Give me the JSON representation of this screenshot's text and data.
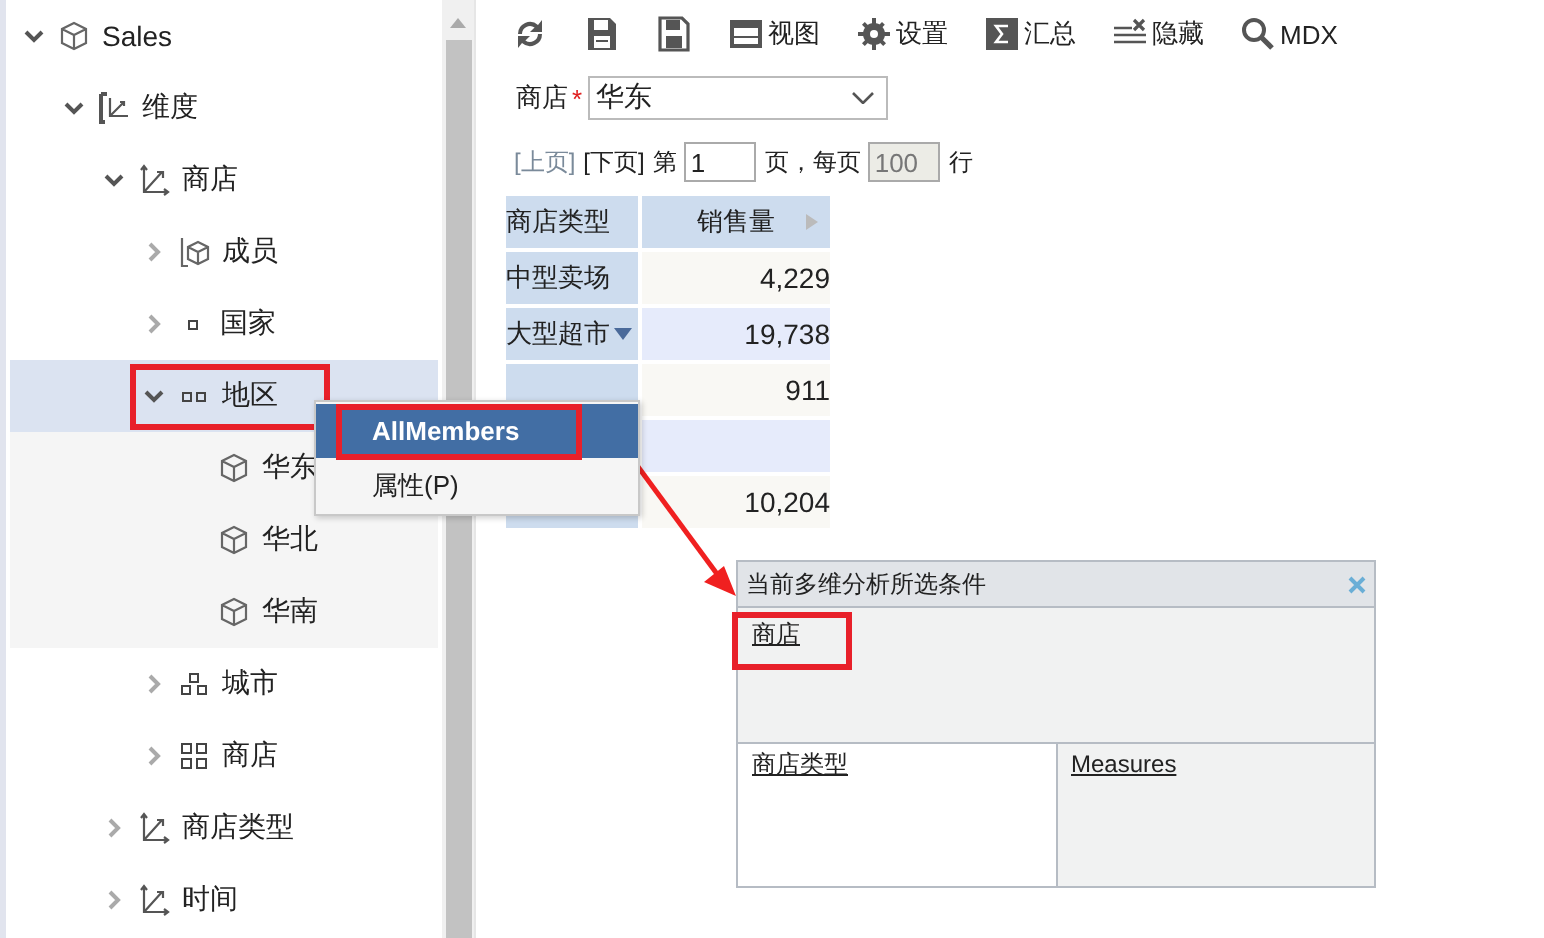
{
  "tree": [
    {
      "label": "Sales",
      "kind": "cube",
      "expanded": true,
      "selected": false,
      "highlighted": false,
      "children": [
        {
          "label": "维度",
          "kind": "dimensions",
          "expanded": true,
          "selected": false,
          "highlighted": false,
          "children": [
            {
              "label": "商店",
              "kind": "hierarchy",
              "expanded": true,
              "selected": false,
              "highlighted": false,
              "children": [
                {
                  "label": "成员",
                  "kind": "members",
                  "expanded": false,
                  "selected": false,
                  "highlighted": false
                },
                {
                  "label": "国家",
                  "kind": "dot",
                  "expanded": false,
                  "selected": false,
                  "highlighted": false
                },
                {
                  "label": "地区",
                  "kind": "pair",
                  "expanded": true,
                  "selected": true,
                  "highlighted": true,
                  "children": [
                    {
                      "label": "华东",
                      "kind": "cube",
                      "selected": false,
                      "highlighted": false
                    },
                    {
                      "label": "华北",
                      "kind": "cube",
                      "selected": false,
                      "highlighted": false
                    },
                    {
                      "label": "华南",
                      "kind": "cube",
                      "selected": false,
                      "highlighted": false
                    }
                  ]
                },
                {
                  "label": "城市",
                  "kind": "triple",
                  "expanded": false,
                  "selected": false,
                  "highlighted": false
                },
                {
                  "label": "商店",
                  "kind": "grid",
                  "expanded": false,
                  "selected": false,
                  "highlighted": false
                }
              ]
            },
            {
              "label": "商店类型",
              "kind": "hierarchy",
              "expanded": false,
              "selected": false,
              "highlighted": false
            },
            {
              "label": "时间",
              "kind": "hierarchy",
              "expanded": false,
              "selected": false,
              "highlighted": false
            }
          ]
        }
      ]
    }
  ],
  "toolbar": [
    {
      "kind": "refresh"
    },
    {
      "kind": "save"
    },
    {
      "kind": "saveas"
    },
    {
      "kind": "view",
      "label": "视图"
    },
    {
      "kind": "settings",
      "label": "设置"
    },
    {
      "kind": "sum",
      "label": "汇总"
    },
    {
      "kind": "hide",
      "label": "隐藏"
    },
    {
      "kind": "search",
      "label": "MDX"
    }
  ],
  "filter": {
    "label": "商店",
    "required_mark": "*",
    "value": "华东"
  },
  "pager": {
    "prev": "[上页]",
    "prev_disabled": true,
    "next": "[下页]",
    "page_prefix": "第",
    "page": "1",
    "page_suffix": "页，每页",
    "page_size": "100",
    "rows_suffix": "行"
  },
  "table": {
    "columns": [
      "商店类型",
      "销售量"
    ],
    "rows": [
      {
        "label": "中型卖场",
        "value": "4,229",
        "filter_mark": false
      },
      {
        "label": "大型超市",
        "value": "19,738",
        "filter_mark": true
      },
      {
        "value": "911",
        "filter_mark": false
      },
      {},
      {
        "value": "10,204"
      }
    ]
  },
  "context_menu": {
    "items": [
      {
        "label": "AllMembers",
        "selected": true,
        "highlighted": true
      },
      {
        "label": "属性(P)",
        "selected": false,
        "highlighted": false
      }
    ]
  },
  "conditions_panel": {
    "title": "当前多维分析所选条件",
    "filter_items": [
      {
        "label": "商店",
        "highlighted": true
      }
    ],
    "row_items": [
      {
        "label": "商店类型",
        "highlighted": false
      }
    ],
    "column_items": [
      {
        "label": "Measures",
        "highlighted": false
      }
    ]
  }
}
